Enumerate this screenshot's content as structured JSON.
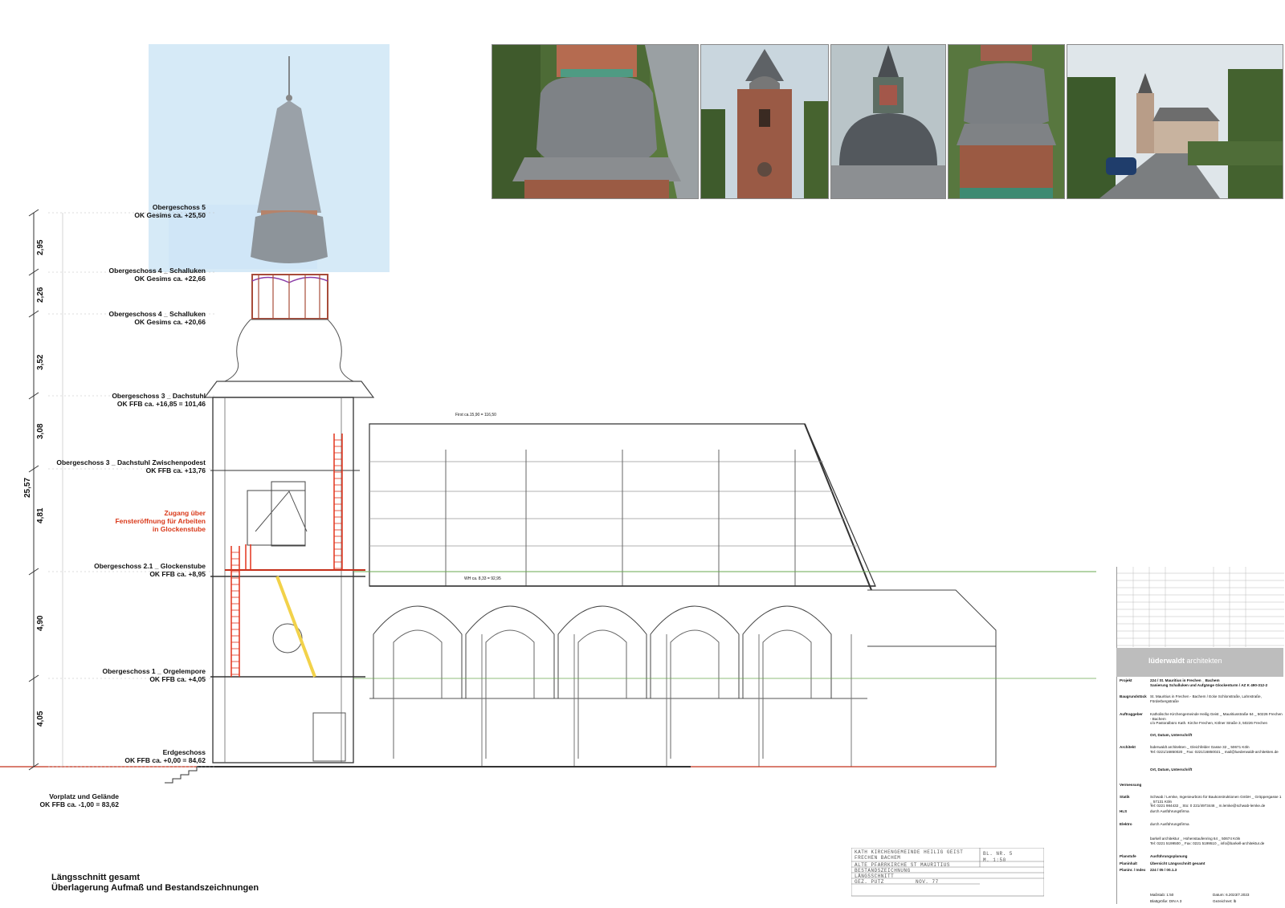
{
  "photos": [
    {
      "name": "photo-dome-top-view"
    },
    {
      "name": "photo-tower-front"
    },
    {
      "name": "photo-dome-belfry"
    },
    {
      "name": "photo-dome-side"
    },
    {
      "name": "photo-church-street"
    }
  ],
  "levels": [
    {
      "line1": "Obergeschoss 5",
      "line2": "OK Gesims ca. +25,50"
    },
    {
      "line1": "Obergeschoss 4 _ Schalluken",
      "line2": "OK Gesims ca. +22,66"
    },
    {
      "line1": "Obergeschoss 4 _ Schalluken",
      "line2": "OK Gesims ca. +20,66"
    },
    {
      "line1": "Obergeschoss 3 _ Dachstuhl",
      "line2": "OK FFB ca. +16,85 = 101,46"
    },
    {
      "line1": "Obergeschoss 3 _ Dachstuhl Zwischenpodest",
      "line2": "OK FFB ca. +13,76"
    },
    {
      "line1": "Obergeschoss 2.1 _ Glockenstube",
      "line2": "OK FFB ca. +8,95"
    },
    {
      "line1": "Obergeschoss 1 _ Orgelempore",
      "line2": "OK FFB ca. +4,05"
    },
    {
      "line1": "Erdgeschoss",
      "line2": "OK FFB ca. +0,00 = 84,62"
    }
  ],
  "access_note": {
    "line1": "Zugang über",
    "line2": "Fensteröffnung für Arbeiten",
    "line3": "in Glockenstube"
  },
  "ground_note": {
    "line1": "Vorplatz und Gelände",
    "line2": "OK FFB ca. -1,00 = 83,62"
  },
  "dimensions": [
    "2,95",
    "2,26",
    "3,52",
    "3,08",
    "4,81",
    "4,90",
    "4,05"
  ],
  "total_height": "25,57",
  "roof_labels": {
    "ridge": "First ca.15,90 = 116,50",
    "eaves": "WH ca. 8,33 = 92,95"
  },
  "firm": {
    "name_bold": "lüderwaldt",
    "name_light": " architekten"
  },
  "title_block": [
    {
      "key": "Projekt",
      "value": "224 / St. Mauritius in Frechen _ Bachem",
      "value2": "Sanierung Schalluken und Aufgänge Glockenturm / AZ K 490-312-2"
    },
    {
      "key": "Baugrundstück",
      "value": "St. Mauritius in Frechen - Bachem / Ecke Schlonstraße, Lahnstraße, Förderbergstraße",
      "value2": ""
    },
    {
      "key": "Auftraggeber",
      "value": "Katholische Kirchengemeinde Heilig Geist _ Mauritiusstraße 64 _ 50226 Frechen - Bachem",
      "value2": "c/o Pastoralbüro Kath. Kirche Frechen, Kölner Straße 3, 50226 Frechen"
    },
    {
      "key": "",
      "value": "Ort, Datum, Unterschrift",
      "value2": ""
    },
    {
      "key": "Architekt",
      "value": "lüderwaldt architekten _ Gleichfelder Gasse 32 _ 50671 Köln",
      "value2": "Tel: 0221/16850020 _ Fax: 0221/16850021 _ mail@luederwaldt-architekten.de"
    },
    {
      "key": "",
      "value": "Ort, Datum, Unterschrift",
      "value2": ""
    },
    {
      "key": "Vermessung",
      "value": "",
      "value2": ""
    },
    {
      "key": "Statik",
      "value": "Schwab / Lemke, Ingenieurbüro für Baukonstruktionen GmbH _ Gröppergasse 1 _ 57131 Köln",
      "value2": "Tel: 0221 984432 _ Sto: 0 221/4973446 _ m.lemke@schwab-lemke.de"
    },
    {
      "key": "HLS",
      "value": "durch Ausführungsfirma",
      "value2": ""
    },
    {
      "key": "Elektro",
      "value": "durch Ausführungsfirma",
      "value2": ""
    },
    {
      "key": "",
      "value": "barkell architektur _ Hohenstaufenring 64 _ 50674 Köln",
      "value2": "Tel: 0221 5199500 _ Fax: 0221 5199510 _ info@barkell-architektur.de"
    },
    {
      "key": "Planstufe",
      "value": "Ausführungsplanung",
      "value2": ""
    },
    {
      "key": "Planinhalt",
      "value": "Übersicht Längsschnitt gesamt",
      "value2": ""
    },
    {
      "key": "Planinr. / Index",
      "value": "224 / 05 / 00.1.3",
      "value2": ""
    }
  ],
  "tb_footer": {
    "scale": "Maßstab: 1:50",
    "size": "Blattgröße: DIN A 3",
    "date": "Datum: 6.2023/7.2023",
    "drawn": "Gezeichnet: lb"
  },
  "stamp": {
    "r1": "KATH KIRCHENGEMEINDE HEILIG GEIST",
    "r2": "FRECHEN BACHEM",
    "r3": "ALTE PFARRKIRCHE ST MAURITIUS",
    "r4": "BESTANDSZEICHNUNG",
    "r5": "LÄNGSSCHNITT",
    "r6": "GEZ. PUTZ",
    "r6b": "NOV. 77",
    "blatt": "BL. NR. 5",
    "scale": "M. 1:50"
  },
  "sheet_title": {
    "line1": "Längsschnitt gesamt",
    "line2": "Überlagerung Aufmaß und Bestandszeichnungen"
  },
  "colors": {
    "red_annotation": "#d9391a",
    "ladder_red": "#e2331c",
    "ladder_yellow": "#f2d24a",
    "sky": "#cfe6f6",
    "firm_bar": "#bdbdbd",
    "green_line": "#6aa84f"
  }
}
